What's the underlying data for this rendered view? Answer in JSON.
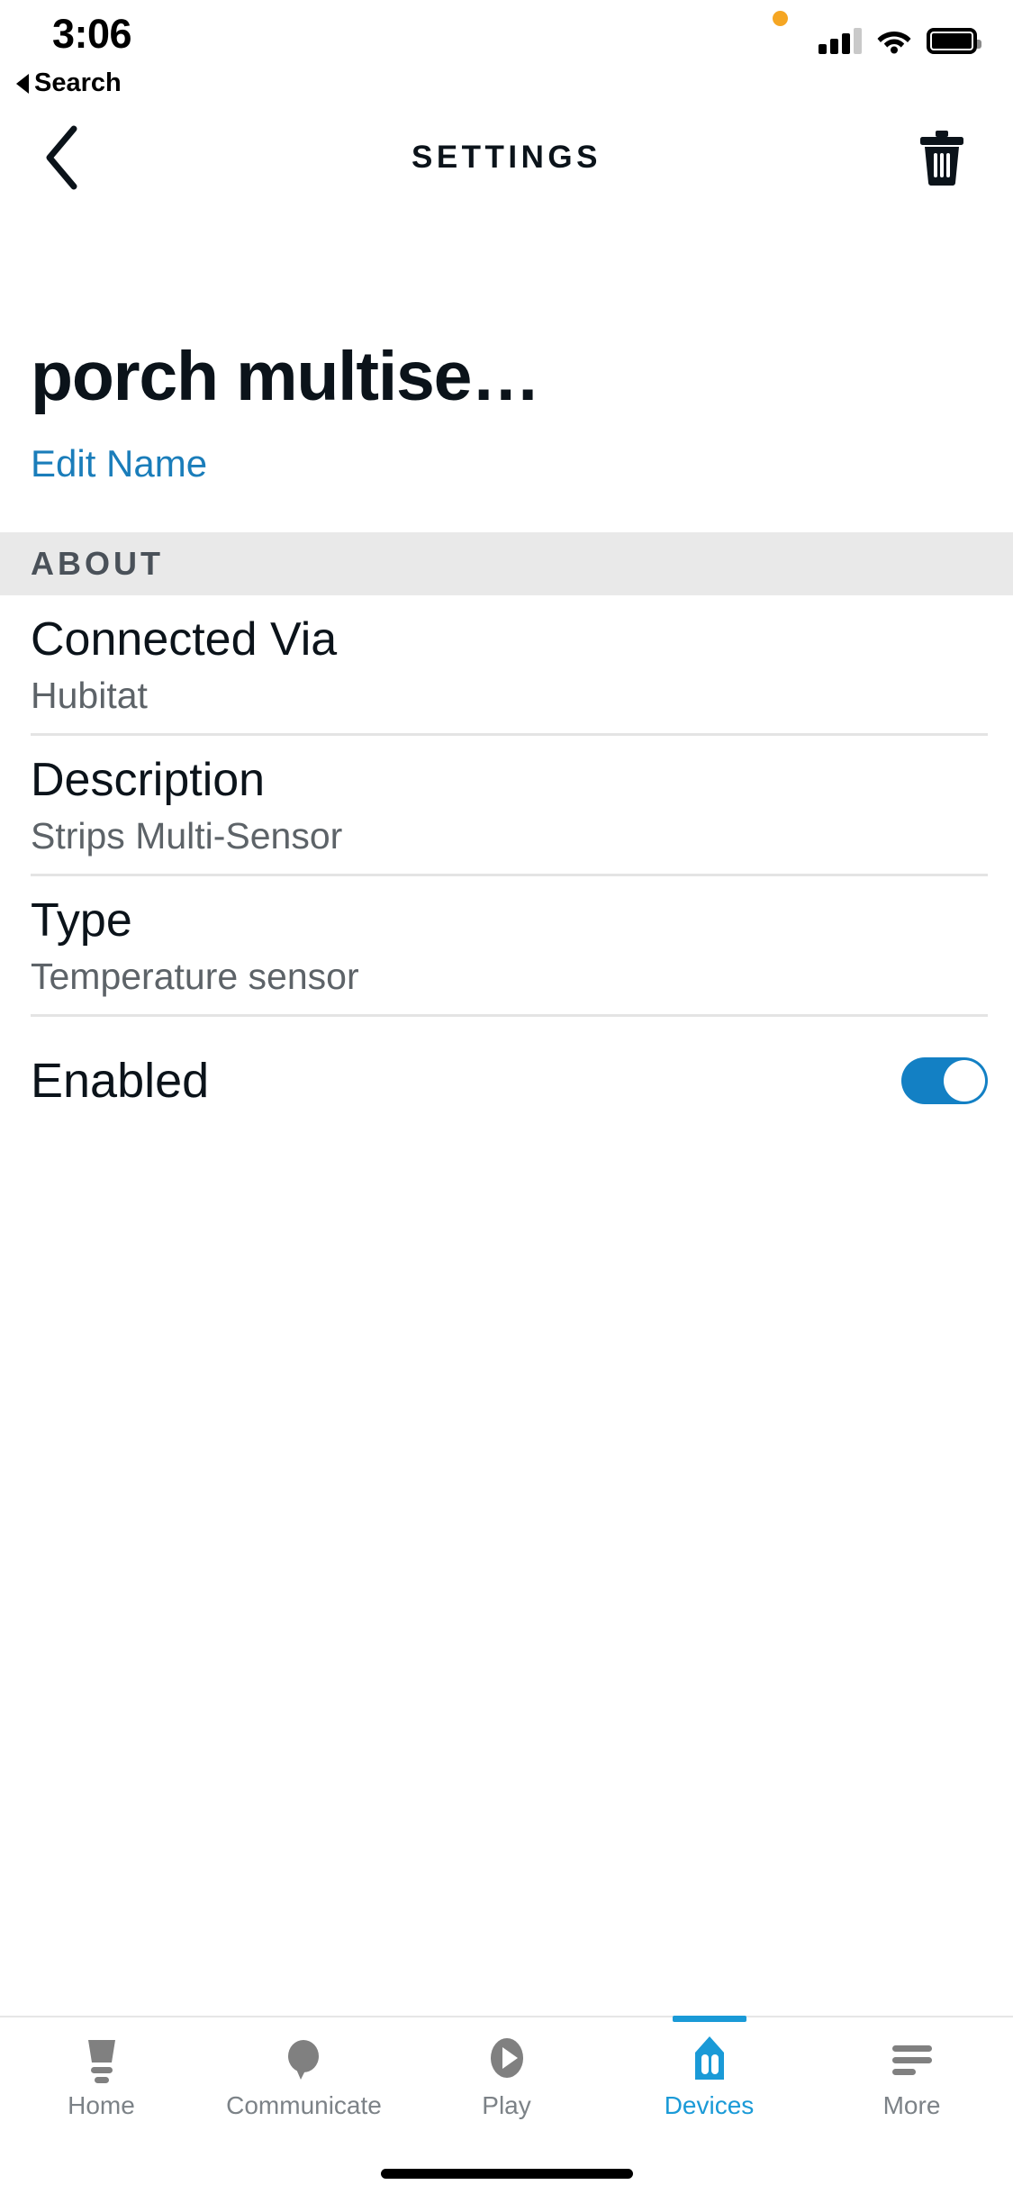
{
  "status_bar": {
    "time": "3:06",
    "back_app_label": "Search",
    "icons": {
      "back_triangle": "back-triangle-icon",
      "recording_dot": "orange-recording-dot",
      "signal": "cellular-signal-icon",
      "wifi": "wifi-icon",
      "battery": "battery-icon"
    }
  },
  "nav_bar": {
    "title": "SETTINGS",
    "back_icon": "chevron-left-icon",
    "delete_icon": "trash-icon"
  },
  "device": {
    "name": "porch multise…",
    "edit_name_label": "Edit Name"
  },
  "about_section": {
    "header": "ABOUT",
    "rows": [
      {
        "label": "Connected Via",
        "value": "Hubitat"
      },
      {
        "label": "Description",
        "value": "Strips Multi-Sensor"
      },
      {
        "label": "Type",
        "value": "Temperature sensor"
      }
    ],
    "enabled_row": {
      "label": "Enabled",
      "state": "on"
    }
  },
  "tab_bar": {
    "active_index": 3,
    "tabs": [
      {
        "label": "Home",
        "icon": "home-icon"
      },
      {
        "label": "Communicate",
        "icon": "speech-bubble-icon"
      },
      {
        "label": "Play",
        "icon": "play-circle-icon"
      },
      {
        "label": "Devices",
        "icon": "devices-house-icon"
      },
      {
        "label": "More",
        "icon": "hamburger-menu-icon"
      }
    ]
  },
  "colors": {
    "accent_blue": "#1a9ad7",
    "link_blue": "#1a7dba",
    "toggle_on": "#1380c4",
    "section_bg": "#e9e9e9",
    "text_primary": "#0b131a",
    "text_secondary": "#5d6368",
    "status_orange": "#f5a623"
  }
}
